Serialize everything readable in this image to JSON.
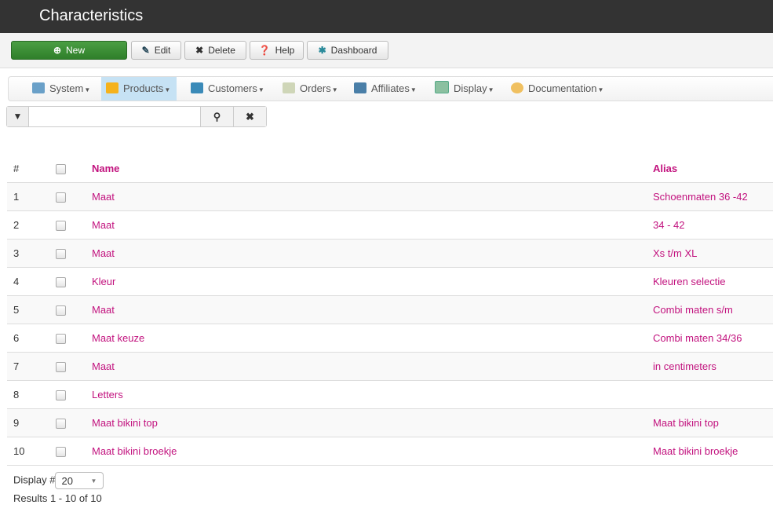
{
  "title": "Characteristics",
  "toolbar": {
    "new": "New",
    "edit": "Edit",
    "delete": "Delete",
    "help": "Help",
    "dashboard": "Dashboard"
  },
  "menu": [
    {
      "label": "System",
      "icon": "tools-icon"
    },
    {
      "label": "Products",
      "icon": "box-icon"
    },
    {
      "label": "Customers",
      "icon": "users-icon"
    },
    {
      "label": "Orders",
      "icon": "orders-icon"
    },
    {
      "label": "Affiliates",
      "icon": "affiliates-icon"
    },
    {
      "label": "Display",
      "icon": "display-icon"
    },
    {
      "label": "Documentation",
      "icon": "help-lifebuoy-icon"
    }
  ],
  "filter": {
    "value": "",
    "placeholder": ""
  },
  "table": {
    "headers": {
      "num": "#",
      "name": "Name",
      "alias": "Alias"
    },
    "rows": [
      {
        "num": "1",
        "name": "Maat",
        "alias": "Schoenmaten 36 -42"
      },
      {
        "num": "2",
        "name": "Maat",
        "alias": "34 - 42"
      },
      {
        "num": "3",
        "name": "Maat",
        "alias": "Xs t/m XL"
      },
      {
        "num": "4",
        "name": "Kleur",
        "alias": "Kleuren selectie"
      },
      {
        "num": "5",
        "name": "Maat",
        "alias": "Combi maten s/m"
      },
      {
        "num": "6",
        "name": "Maat keuze",
        "alias": "Combi maten 34/36"
      },
      {
        "num": "7",
        "name": "Maat",
        "alias": "in centimeters"
      },
      {
        "num": "8",
        "name": "Letters",
        "alias": ""
      },
      {
        "num": "9",
        "name": "Maat bikini top",
        "alias": "Maat bikini top"
      },
      {
        "num": "10",
        "name": "Maat bikini broekje",
        "alias": "Maat bikini broekje"
      }
    ]
  },
  "footer": {
    "display_label": "Display #",
    "display_value": "20",
    "results": "Results 1 - 10 of 10"
  }
}
